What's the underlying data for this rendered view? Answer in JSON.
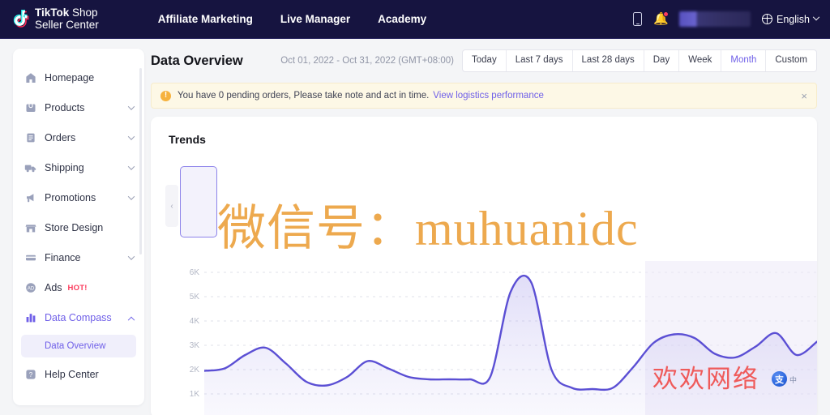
{
  "topnav": {
    "brand_line1_bold": "TikTok",
    "brand_line1_light": " Shop",
    "brand_line2": "Seller Center",
    "links": [
      {
        "label": "Affiliate Marketing"
      },
      {
        "label": "Live Manager"
      },
      {
        "label": "Academy"
      }
    ],
    "icons": {
      "phone": "phone-icon",
      "bell": "bell-icon"
    },
    "language": "English"
  },
  "sidebar": {
    "items": [
      {
        "label": "Homepage",
        "icon": "home-icon",
        "expandable": false,
        "active": false
      },
      {
        "label": "Products",
        "icon": "box-icon",
        "expandable": true,
        "active": false
      },
      {
        "label": "Orders",
        "icon": "clipboard-icon",
        "expandable": true,
        "active": false
      },
      {
        "label": "Shipping",
        "icon": "truck-icon",
        "expandable": true,
        "active": false
      },
      {
        "label": "Promotions",
        "icon": "megaphone-icon",
        "expandable": true,
        "active": false
      },
      {
        "label": "Store Design",
        "icon": "storefront-icon",
        "expandable": false,
        "active": false
      },
      {
        "label": "Finance",
        "icon": "card-icon",
        "expandable": true,
        "active": false
      },
      {
        "label": "Ads",
        "icon": "ads-icon",
        "expandable": false,
        "active": false,
        "badge": "HOT!"
      },
      {
        "label": "Data Compass",
        "icon": "bar-chart-icon",
        "expandable": true,
        "active": true,
        "expanded": true
      },
      {
        "label": "Help Center",
        "icon": "help-icon",
        "expandable": false,
        "active": false
      }
    ],
    "sub_item": "Data Overview"
  },
  "page": {
    "title": "Data Overview",
    "date_range": "Oct 01, 2022 - Oct 31, 2022 (GMT+08:00)",
    "segments": [
      {
        "label": "Today",
        "selected": false
      },
      {
        "label": "Last 7 days",
        "selected": false
      },
      {
        "label": "Last 28 days",
        "selected": false
      },
      {
        "label": "Day",
        "selected": false
      },
      {
        "label": "Week",
        "selected": false
      },
      {
        "label": "Month",
        "selected": true
      },
      {
        "label": "Custom",
        "selected": false
      }
    ]
  },
  "alert": {
    "icon": "warning-icon",
    "text": "You have 0 pending orders, Please take note and act in time.",
    "link": "View logistics performance",
    "close": "×"
  },
  "trends": {
    "title": "Trends",
    "prev_arrow": "‹"
  },
  "watermarks": {
    "main": "微信号：muhuanidc",
    "red": "欢欢网络",
    "badge": "支",
    "tiny": "中"
  },
  "colors": {
    "nav_bg": "#161440",
    "accent": "#6f5fe8",
    "line": "#5b4fd4",
    "alert_bg": "#fdf8e6",
    "warn": "#f6b23e",
    "hot": "#fb3b5c",
    "wm_orange": "#eda94e",
    "wm_red": "#ef5a5a"
  },
  "chart_data": {
    "type": "area",
    "title": "Trends",
    "xlabel": "",
    "ylabel": "",
    "ylim": [
      0,
      6500
    ],
    "ytick_labels": [
      "6K",
      "5K",
      "4K",
      "3K",
      "2K",
      "1K"
    ],
    "ytick_values": [
      6000,
      5000,
      4000,
      3000,
      2000,
      1000
    ],
    "grid": "dashed-horizontal",
    "legend": "none",
    "series": [
      {
        "name": "Trend",
        "color": "#5b4fd4",
        "values": [
          1950,
          2050,
          2600,
          2900,
          2250,
          1500,
          1350,
          1700,
          2350,
          2050,
          1700,
          1600,
          1600,
          1600,
          1700,
          5200,
          5600,
          2000,
          1250,
          1200,
          1250,
          2100,
          3100,
          3450,
          3300,
          2650,
          2500,
          2950,
          3500,
          2600,
          3150
        ]
      }
    ]
  }
}
